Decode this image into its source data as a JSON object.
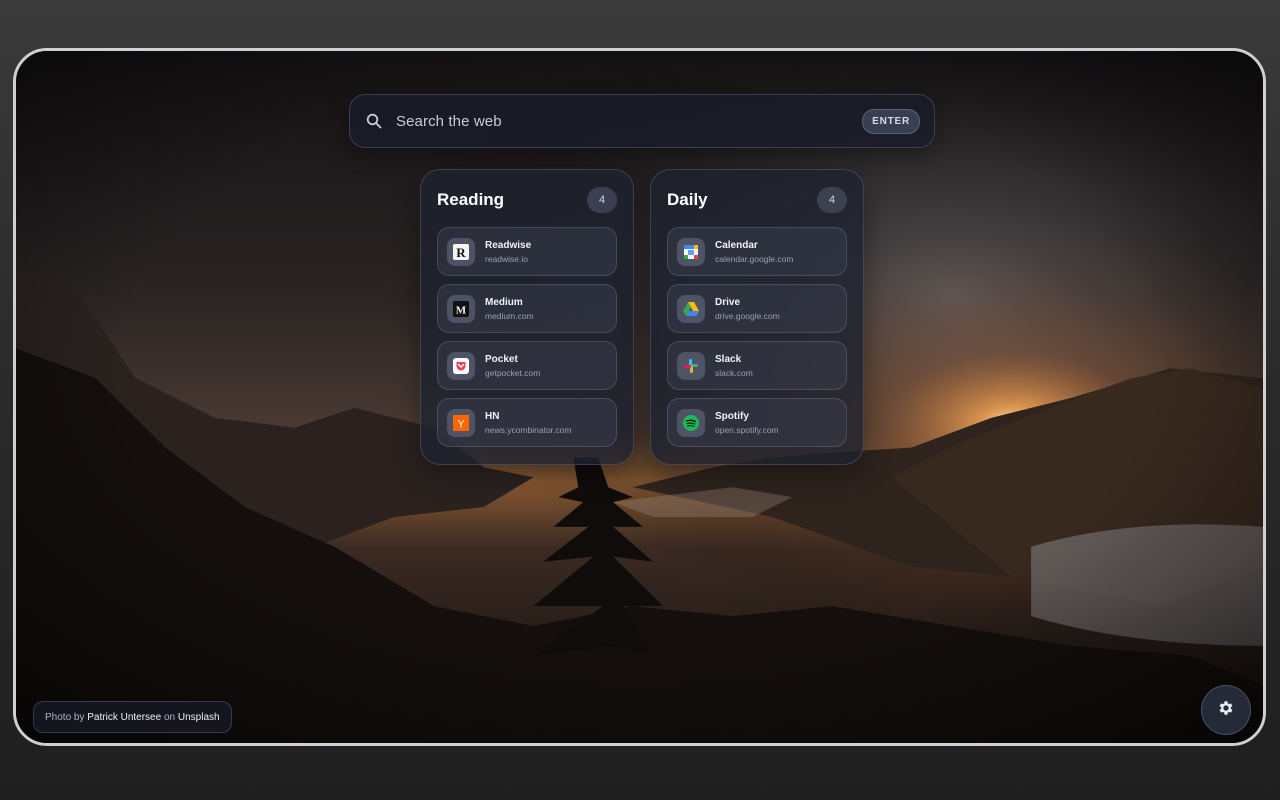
{
  "search": {
    "placeholder": "Search the web",
    "enter_label": "ENTER",
    "icon": "search-icon"
  },
  "groups": [
    {
      "title": "Reading",
      "count": "4",
      "links": [
        {
          "name": "Readwise",
          "url": "readwise.io",
          "icon": "readwise-icon"
        },
        {
          "name": "Medium",
          "url": "medium.com",
          "icon": "medium-icon"
        },
        {
          "name": "Pocket",
          "url": "getpocket.com",
          "icon": "pocket-icon"
        },
        {
          "name": "HN",
          "url": "news.ycombinator.com",
          "icon": "hacker-news-icon"
        }
      ]
    },
    {
      "title": "Daily",
      "count": "4",
      "links": [
        {
          "name": "Calendar",
          "url": "calendar.google.com",
          "icon": "google-calendar-icon"
        },
        {
          "name": "Drive",
          "url": "drive.google.com",
          "icon": "google-drive-icon"
        },
        {
          "name": "Slack",
          "url": "slack.com",
          "icon": "slack-icon"
        },
        {
          "name": "Spotify",
          "url": "open.spotify.com",
          "icon": "spotify-icon"
        }
      ]
    }
  ],
  "credit": {
    "prefix": "Photo by",
    "author": "Patrick Untersee",
    "middle": "on",
    "source": "Unsplash"
  },
  "settings": {
    "icon": "gear-icon"
  },
  "colors": {
    "hn_orange": "#ff6600",
    "spotify_green": "#1db954",
    "pocket_red": "#ef3f56",
    "card_bg": "#1e212e"
  }
}
